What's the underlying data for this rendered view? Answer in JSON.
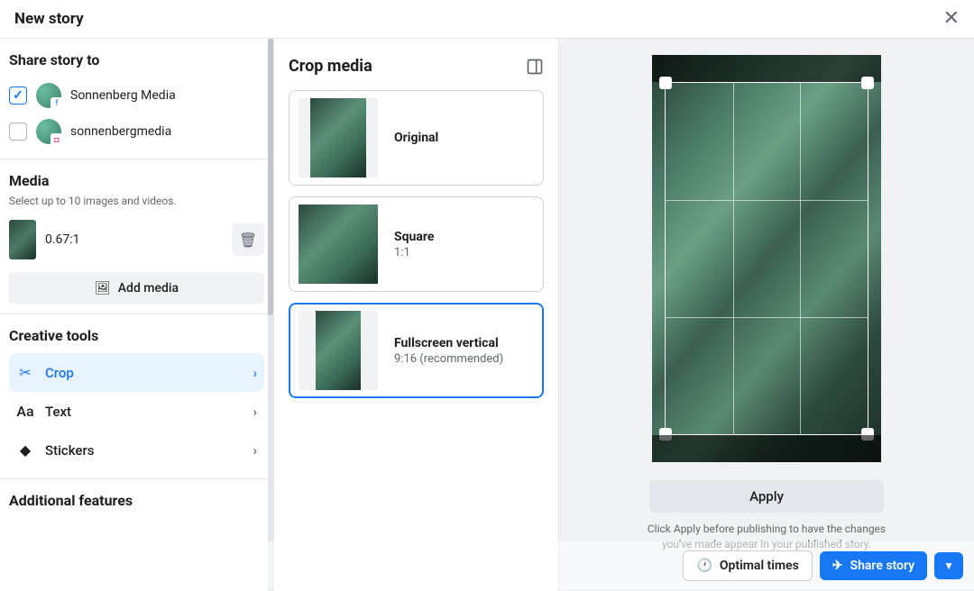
{
  "header": {
    "title": "New story"
  },
  "share": {
    "heading": "Share story to",
    "accounts": [
      {
        "name": "Sonnenberg Media",
        "checked": true,
        "platform": "fb"
      },
      {
        "name": "sonnenbergmedia",
        "checked": false,
        "platform": "ig"
      }
    ]
  },
  "media": {
    "heading": "Media",
    "subtext": "Select up to 10 images and videos.",
    "items": [
      {
        "ratio": "0.67:1"
      }
    ],
    "add_label": "Add media"
  },
  "creative": {
    "heading": "Creative tools",
    "tools": [
      {
        "label": "Crop",
        "icon": "crop-icon",
        "active": true
      },
      {
        "label": "Text",
        "icon": "text-icon",
        "active": false
      },
      {
        "label": "Stickers",
        "icon": "sticker-icon",
        "active": false
      }
    ]
  },
  "additional": {
    "heading": "Additional features"
  },
  "crop": {
    "heading": "Crop media",
    "options": [
      {
        "label": "Original",
        "sub": "",
        "shape": "original",
        "selected": false
      },
      {
        "label": "Square",
        "sub": "1:1",
        "shape": "square",
        "selected": false
      },
      {
        "label": "Fullscreen vertical",
        "sub": "9:16 (recommended)",
        "shape": "vertical",
        "selected": true
      }
    ]
  },
  "preview": {
    "apply_label": "Apply",
    "hint": "Click Apply before publishing to have the changes you've made appear in your published story."
  },
  "footer": {
    "optimal_label": "Optimal times",
    "share_label": "Share story"
  }
}
